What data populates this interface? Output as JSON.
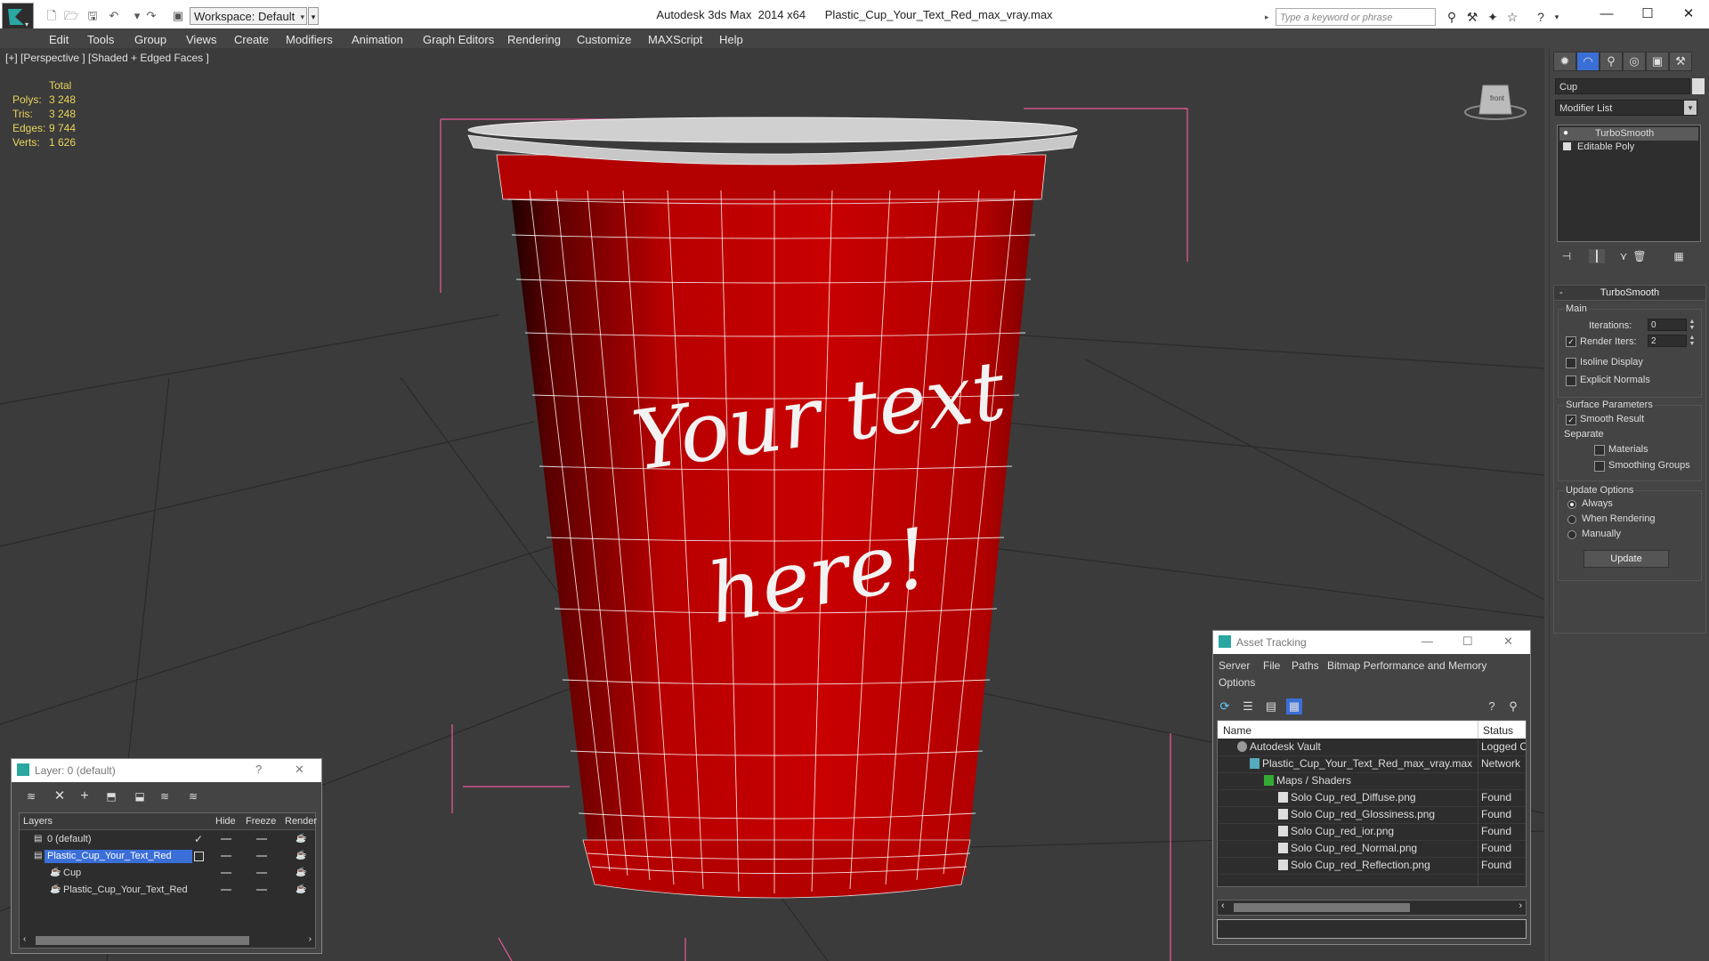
{
  "app": {
    "title": "Autodesk 3ds Max  2014 x64      Plastic_Cup_Your_Text_Red_max_vray.max",
    "workspace": "Workspace: Default",
    "search_placeholder": "Type a keyword or phrase"
  },
  "menu": [
    "Edit",
    "Tools",
    "Group",
    "Views",
    "Create",
    "Modifiers",
    "Animation",
    "Graph Editors",
    "Rendering",
    "Customize",
    "MAXScript",
    "Help"
  ],
  "viewport": {
    "label": "[+] [Perspective ] [Shaded + Edged Faces ]",
    "stats": {
      "header": "Total",
      "rows": [
        {
          "k": "Polys:",
          "v": "3 248"
        },
        {
          "k": "Tris:",
          "v": "3 248"
        },
        {
          "k": "Edges:",
          "v": "9 744"
        },
        {
          "k": "Verts:",
          "v": "1 626"
        }
      ]
    },
    "cup_text_line1": "Your text",
    "cup_text_line2": "here!",
    "viewcube_label": "front"
  },
  "command_panel": {
    "object_name": "Cup",
    "modifier_list": "Modifier List",
    "stack": [
      "TurboSmooth",
      "Editable Poly"
    ],
    "rollout": {
      "title": "TurboSmooth",
      "main_label": "Main",
      "iterations_label": "Iterations:",
      "iterations_value": "0",
      "render_iters_label": "Render Iters:",
      "render_iters_value": "2",
      "isoline": "Isoline Display",
      "explicit_normals": "Explicit Normals",
      "surface_params": "Surface Parameters",
      "smooth_result": "Smooth Result",
      "separate": "Separate",
      "materials": "Materials",
      "smoothing_groups": "Smoothing Groups",
      "update_options": "Update Options",
      "always": "Always",
      "when_rendering": "When Rendering",
      "manually": "Manually",
      "update_button": "Update"
    }
  },
  "layer_window": {
    "title": "Layer: 0 (default)",
    "help": "?",
    "columns": [
      "Layers",
      "Hide",
      "Freeze",
      "Render"
    ],
    "rows": [
      {
        "name": "0 (default)",
        "indent": 1
      },
      {
        "name": "Plastic_Cup_Your_Text_Red",
        "indent": 1
      },
      {
        "name": "Cup",
        "indent": 2
      },
      {
        "name": "Plastic_Cup_Your_Text_Red",
        "indent": 2
      }
    ]
  },
  "asset_tracking": {
    "title": "Asset Tracking",
    "menu": [
      "Server",
      "File",
      "Paths",
      "Bitmap Performance and Memory",
      "Options"
    ],
    "columns": [
      "Name",
      "Status"
    ],
    "rows": [
      {
        "name": "Autodesk Vault",
        "status": "Logged Out",
        "indent": 1
      },
      {
        "name": "Plastic_Cup_Your_Text_Red_max_vray.max",
        "status": "Network",
        "indent": 2
      },
      {
        "name": "Maps / Shaders",
        "status": "",
        "indent": 3
      },
      {
        "name": "Solo Cup_red_Diffuse.png",
        "status": "Found",
        "indent": 4
      },
      {
        "name": "Solo Cup_red_Glossiness.png",
        "status": "Found",
        "indent": 4
      },
      {
        "name": "Solo Cup_red_ior.png",
        "status": "Found",
        "indent": 4
      },
      {
        "name": "Solo Cup_red_Normal.png",
        "status": "Found",
        "indent": 4
      },
      {
        "name": "Solo Cup_red_Reflection.png",
        "status": "Found",
        "indent": 4
      }
    ]
  },
  "colors": {
    "cup_red": "#c50000",
    "viewport_bg": "#3b3b3b",
    "stats_text": "#e8d45a",
    "selection": "#3b6fd8",
    "bbox_pink": "#e85a9a"
  }
}
